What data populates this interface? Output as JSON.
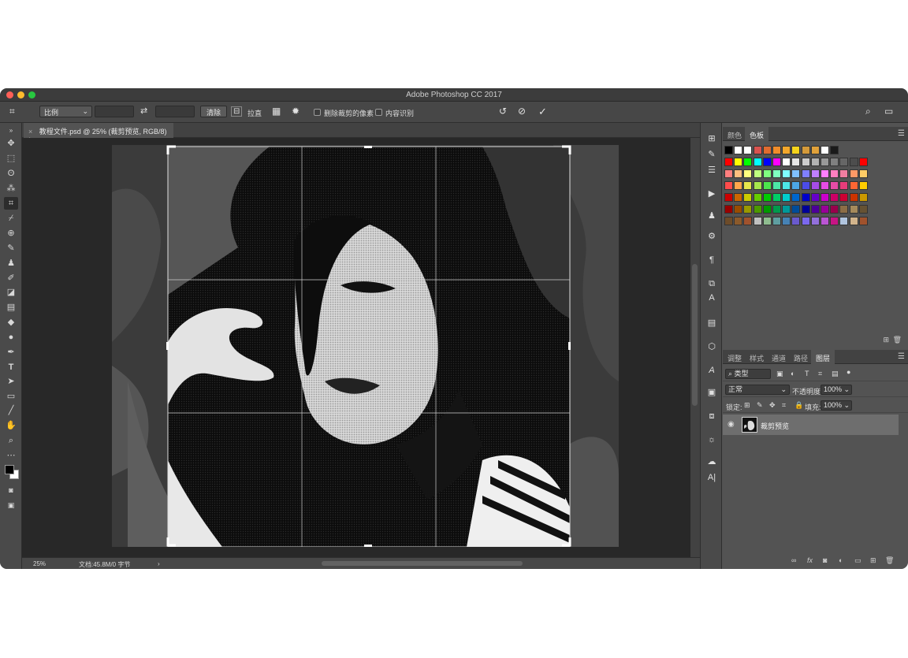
{
  "window": {
    "title": "Adobe Photoshop CC 2017"
  },
  "options_bar": {
    "ratio_select": "比例",
    "clear_label": "清除",
    "straighten_label": "拉直",
    "delete_cropped_label": "删除裁剪的像素",
    "content_aware_label": "内容识别",
    "confirm_icon": "check-icon",
    "cancel_icon": "cancel-icon",
    "reset_icon": "reset-icon"
  },
  "document": {
    "tab_title": "教程文件.psd @ 25% (裁剪预览, RGB/8) *"
  },
  "status": {
    "zoom": "25%",
    "doc_size": "文档:45.8M/0 字节"
  },
  "swatches_panel": {
    "tabs": [
      "颜色",
      "色板"
    ],
    "active_tab": "色板",
    "colors": [
      [
        "#000000",
        "#ffffff",
        "#ffffff",
        "#d9534f",
        "#e06b2f",
        "#f08c2a",
        "#f3a72b",
        "#f5d31b",
        "#d49a3a",
        "#e0a13a",
        "#ffffff",
        "#1a1a1a"
      ],
      [
        "#ff0000",
        "#ffff00",
        "#00ff00",
        "#00ffff",
        "#0000ff",
        "#ff00ff",
        "#ffffff",
        "#e6e6e6",
        "#cccccc",
        "#b3b3b3",
        "#999999",
        "#808080",
        "#666666",
        "#4d4d4d",
        "#ff0000"
      ],
      [
        "#ff7f7f",
        "#ffbf7f",
        "#ffff7f",
        "#bfff7f",
        "#7fff7f",
        "#7fffbf",
        "#7fffff",
        "#7fbfff",
        "#7f7fff",
        "#bf7fff",
        "#ff7fff",
        "#ff7fbf",
        "#f27ea1",
        "#ff9966",
        "#ffcc66"
      ],
      [
        "#ff4c4c",
        "#ffa64c",
        "#e6e64c",
        "#a6e64c",
        "#4ce64c",
        "#4ce6a6",
        "#4ce6e6",
        "#4ca6e6",
        "#4c4ce6",
        "#a64ce6",
        "#e64ce6",
        "#e64ca6",
        "#e63c7a",
        "#ff6633",
        "#ffcc00"
      ],
      [
        "#cc0000",
        "#cc6600",
        "#cccc00",
        "#66cc00",
        "#00cc00",
        "#00cc66",
        "#00cccc",
        "#0066cc",
        "#0000cc",
        "#6600cc",
        "#cc00cc",
        "#cc0066",
        "#cc0033",
        "#cc3300",
        "#cc9900"
      ],
      [
        "#990000",
        "#994c00",
        "#999900",
        "#4c9900",
        "#009900",
        "#00994c",
        "#009999",
        "#004c99",
        "#000099",
        "#4c0099",
        "#990099",
        "#99004c",
        "#8c6d46",
        "#a68a5b",
        "#665233"
      ],
      [
        "#6d4c2a",
        "#8b5a2b",
        "#a0522d",
        "#c0c0c0",
        "#8fbc8f",
        "#5f9ea0",
        "#4682b4",
        "#6a5acd",
        "#7b68ee",
        "#9370db",
        "#ba55d3",
        "#c71585",
        "#b0c4de",
        "#d2b48c",
        "#a0522d"
      ]
    ]
  },
  "layers_panel": {
    "tabs": [
      "调整",
      "样式",
      "通道",
      "路径",
      "图层"
    ],
    "active_tab": "图层",
    "filter_label": "类型",
    "blend_mode": "正常",
    "opacity_label": "不透明度:",
    "opacity_value": "100%",
    "lock_label": "锁定:",
    "fill_label": "填充:",
    "fill_value": "100%",
    "layer_name": "裁剪预览"
  }
}
